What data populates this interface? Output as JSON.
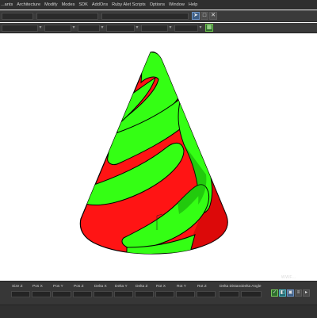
{
  "menubar": {
    "items": [
      "...ants",
      "Architecture",
      "Modify",
      "Modes",
      "SDK",
      "AddOns",
      "Ruby Alet Scripts",
      "Options",
      "Window",
      "Help"
    ]
  },
  "toolbar": {
    "icons": [
      "cursor-icon",
      "square-icon",
      "x-icon",
      "grid-icon",
      "arrow-icon"
    ]
  },
  "viewport": {
    "object": "spiral-cone",
    "colors": {
      "cone_red": "#ff1a1a",
      "cone_shadow": "#b30000",
      "ribbon_green": "#33ff1a",
      "ribbon_shadow": "#1aaa0a",
      "outline": "#000000"
    },
    "watermark": "WWF..."
  },
  "status_fields": [
    {
      "label": "Size Z"
    },
    {
      "label": "Pos X"
    },
    {
      "label": "Pos Y"
    },
    {
      "label": "Pos Z"
    },
    {
      "label": "Delta X"
    },
    {
      "label": "Delta Y"
    },
    {
      "label": "Delta Z"
    },
    {
      "label": "Rot X"
    },
    {
      "label": "Rot Y"
    },
    {
      "label": "Rot Z"
    },
    {
      "label": "Delta Distanc"
    },
    {
      "label": "Delta Angle"
    }
  ]
}
